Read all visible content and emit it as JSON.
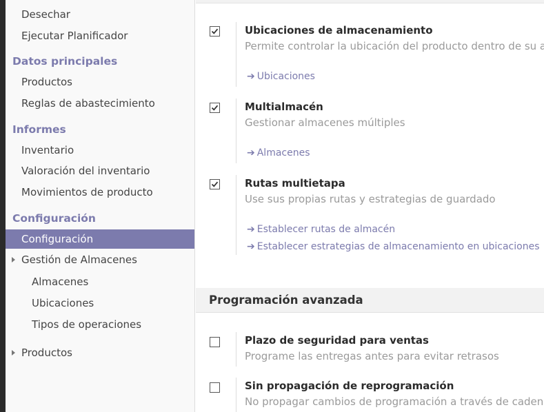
{
  "sidebar": {
    "items": [
      {
        "label": "Desechar",
        "kind": "item"
      },
      {
        "label": "Ejecutar Planificador",
        "kind": "item"
      },
      {
        "label": "Datos principales",
        "kind": "head"
      },
      {
        "label": "Productos",
        "kind": "item"
      },
      {
        "label": "Reglas de abastecimiento",
        "kind": "item"
      },
      {
        "label": "Informes",
        "kind": "head"
      },
      {
        "label": "Inventario",
        "kind": "item"
      },
      {
        "label": "Valoración del inventario",
        "kind": "item"
      },
      {
        "label": "Movimientos de producto",
        "kind": "item"
      },
      {
        "label": "Configuración",
        "kind": "head"
      },
      {
        "label": "Configuración",
        "kind": "item",
        "active": true
      },
      {
        "label": "Gestión de Almacenes",
        "kind": "item",
        "expandable": true
      },
      {
        "label": "Almacenes",
        "kind": "sub"
      },
      {
        "label": "Ubicaciones",
        "kind": "sub"
      },
      {
        "label": "Tipos de operaciones",
        "kind": "sub"
      },
      {
        "label": "Productos",
        "kind": "item",
        "expandable": true
      }
    ]
  },
  "settings": [
    {
      "title": "Ubicaciones de almacenamiento",
      "description": "Permite controlar la ubicación del producto dentro de su almacén",
      "checked": true,
      "links": [
        "Ubicaciones"
      ]
    },
    {
      "title": "Multialmacén",
      "description": "Gestionar almacenes múltiples",
      "checked": true,
      "links": [
        "Almacenes"
      ]
    },
    {
      "title": "Rutas multietapa",
      "description": "Use sus propias rutas y estrategias de guardado",
      "checked": true,
      "links": [
        "Establecer rutas de almacén",
        "Establecer estrategias de almacenamiento en ubicaciones"
      ]
    }
  ],
  "section": {
    "title": "Programación avanzada"
  },
  "advanced": [
    {
      "title": "Plazo de seguridad para ventas",
      "description": "Programe las entregas antes para evitar retrasos",
      "checked": false
    },
    {
      "title": "Sin propagación de reprogramación",
      "description": "No propagar cambios de programación a través de cadenas de movimientos",
      "checked": false
    }
  ],
  "colors": {
    "accent": "#7c7bad",
    "muted_text": "#9a9a9a",
    "sidebar_bg": "#f9f9f9"
  },
  "icons": {
    "link_arrow": "arrow-right-icon",
    "expand": "caret-right-icon",
    "checkbox": "check-icon"
  }
}
